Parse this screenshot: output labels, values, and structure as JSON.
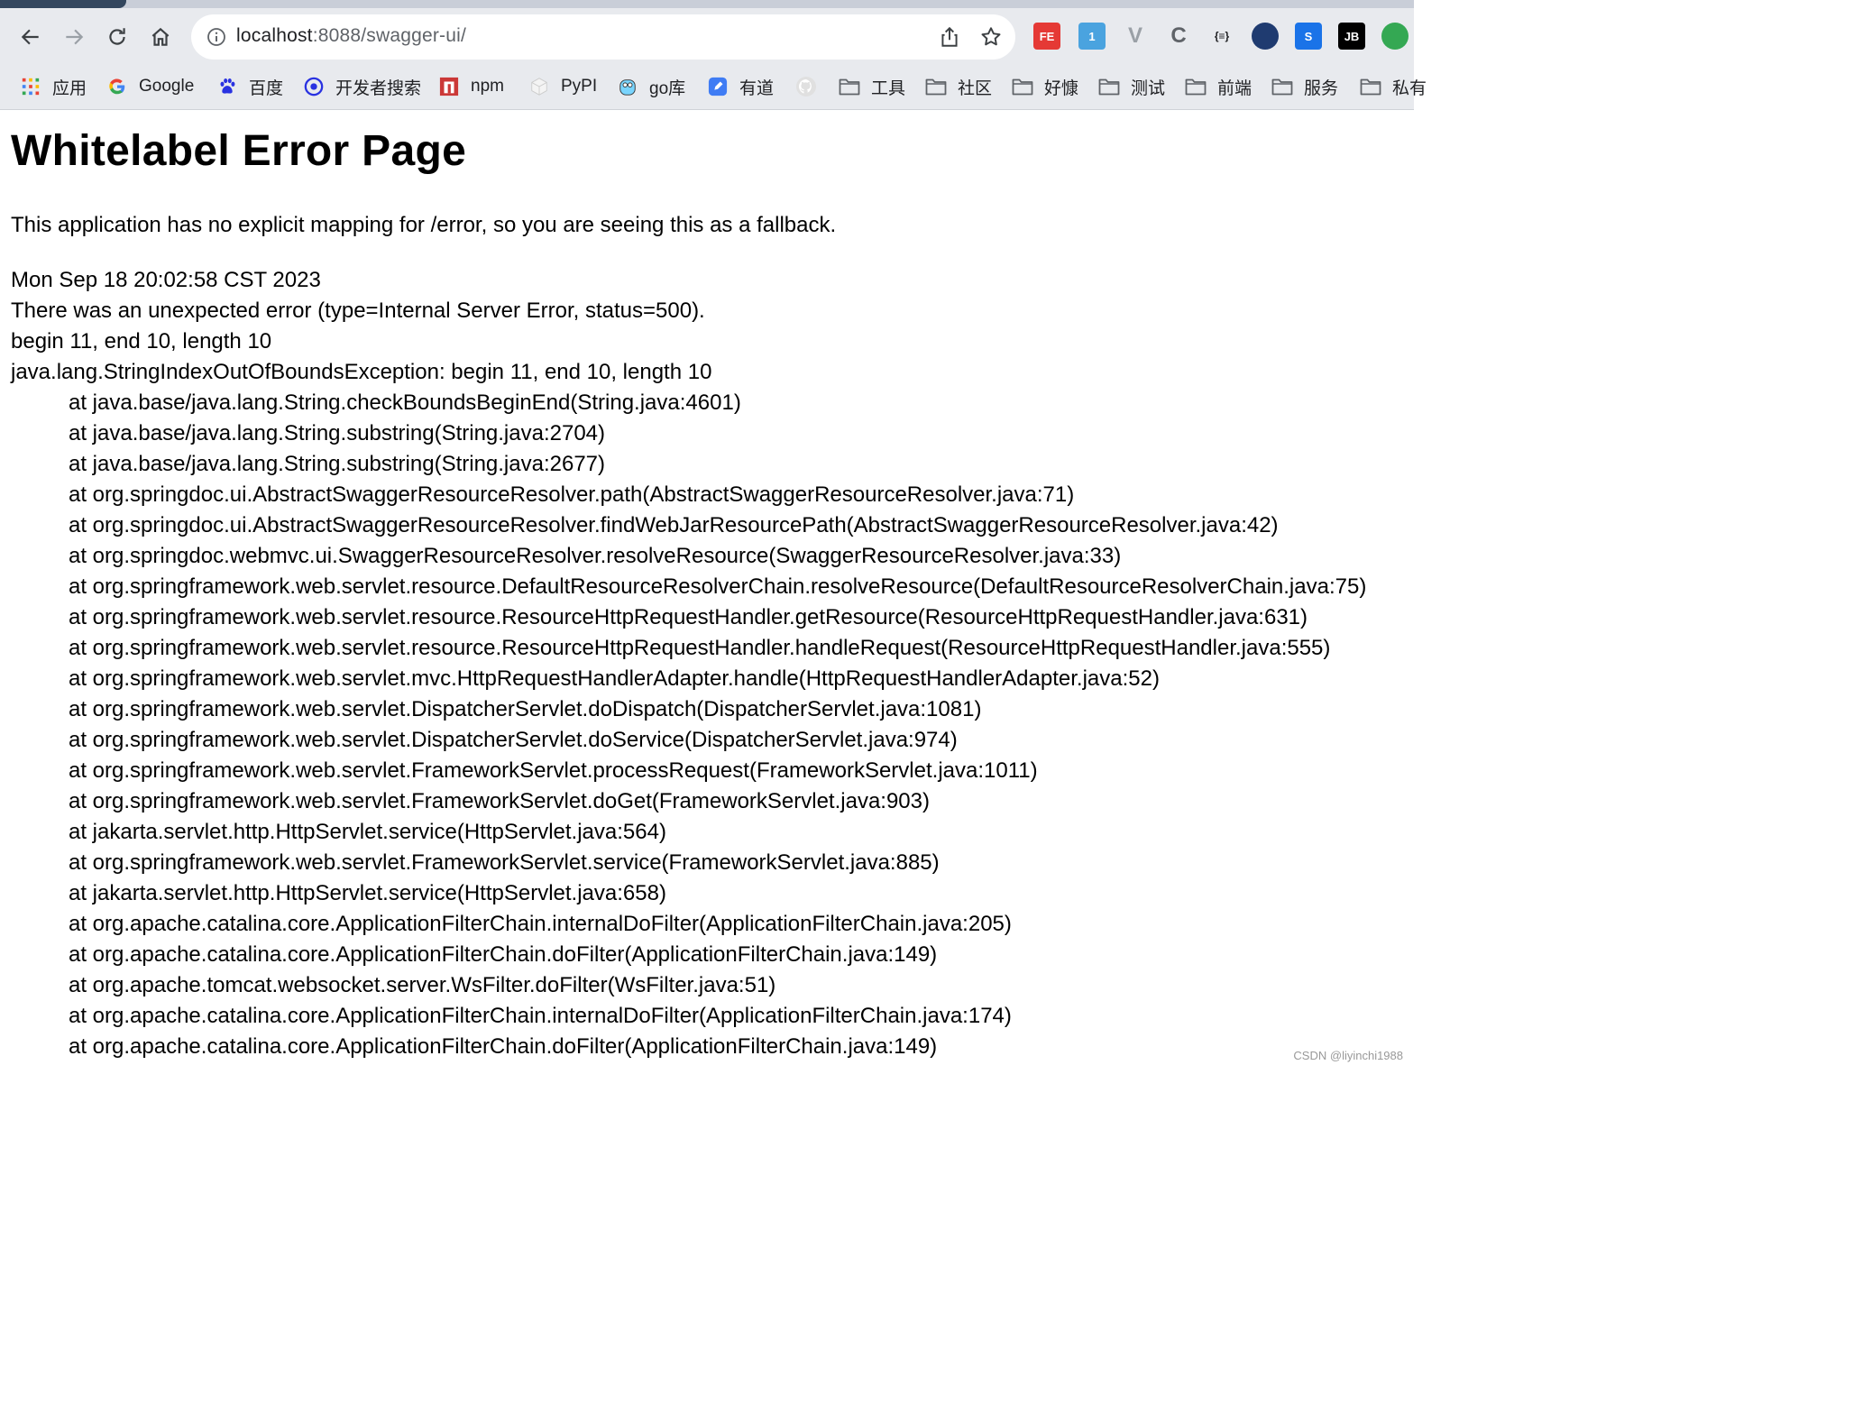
{
  "browser": {
    "address": {
      "host": "localhost",
      "rest": ":8088/swagger-ui/"
    },
    "extensions": [
      {
        "name": "fe-helper-extension",
        "label": "FE",
        "color": "#e53935"
      },
      {
        "name": "screen-capture-extension",
        "label": "1",
        "color": "#4aa3df"
      },
      {
        "name": "vue-devtools-extension",
        "label": "V",
        "color": "#9aa0a6"
      },
      {
        "name": "c-extension",
        "label": "C",
        "color": "#5f6368"
      },
      {
        "name": "json-formatter-extension",
        "label": "{≡}",
        "color": "#202124"
      },
      {
        "name": "compass-extension",
        "label": "",
        "color": "#1f3b70"
      },
      {
        "name": "s-extension",
        "label": "S",
        "color": "#1a73e8"
      },
      {
        "name": "jetbrains-extension",
        "label": "JB",
        "color": "#000000"
      },
      {
        "name": "green-extension",
        "label": "",
        "color": "#34a853"
      }
    ],
    "bookmarks": [
      {
        "label": "应用",
        "icon": "apps-grid-icon"
      },
      {
        "label": "Google",
        "icon": "google-icon"
      },
      {
        "label": "百度",
        "icon": "baidu-paw-icon"
      },
      {
        "label": "开发者搜索",
        "icon": "dev-search-icon"
      },
      {
        "label": "npm",
        "icon": "npm-icon"
      },
      {
        "label": "PyPI",
        "icon": "pypi-icon"
      },
      {
        "label": "go库",
        "icon": "gopher-icon"
      },
      {
        "label": "有道",
        "icon": "youdao-icon"
      },
      {
        "label": "",
        "icon": "github-icon"
      },
      {
        "label": "工具",
        "icon": "folder-icon"
      },
      {
        "label": "社区",
        "icon": "folder-icon"
      },
      {
        "label": "好慷",
        "icon": "folder-icon"
      },
      {
        "label": "测试",
        "icon": "folder-icon"
      },
      {
        "label": "前端",
        "icon": "folder-icon"
      },
      {
        "label": "服务",
        "icon": "folder-icon"
      },
      {
        "label": "私有",
        "icon": "folder-icon"
      }
    ]
  },
  "page": {
    "title": "Whitelabel Error Page",
    "intro": "This application has no explicit mapping for /error, so you are seeing this as a fallback.",
    "timestamp": "Mon Sep 18 20:02:58 CST 2023",
    "error": "There was an unexpected error (type=Internal Server Error, status=500).",
    "message": "begin 11, end 10, length 10",
    "exception": "java.lang.StringIndexOutOfBoundsException: begin 11, end 10, length 10",
    "stack": [
      "at java.base/java.lang.String.checkBoundsBeginEnd(String.java:4601)",
      "at java.base/java.lang.String.substring(String.java:2704)",
      "at java.base/java.lang.String.substring(String.java:2677)",
      "at org.springdoc.ui.AbstractSwaggerResourceResolver.path(AbstractSwaggerResourceResolver.java:71)",
      "at org.springdoc.ui.AbstractSwaggerResourceResolver.findWebJarResourcePath(AbstractSwaggerResourceResolver.java:42)",
      "at org.springdoc.webmvc.ui.SwaggerResourceResolver.resolveResource(SwaggerResourceResolver.java:33)",
      "at org.springframework.web.servlet.resource.DefaultResourceResolverChain.resolveResource(DefaultResourceResolverChain.java:75)",
      "at org.springframework.web.servlet.resource.ResourceHttpRequestHandler.getResource(ResourceHttpRequestHandler.java:631)",
      "at org.springframework.web.servlet.resource.ResourceHttpRequestHandler.handleRequest(ResourceHttpRequestHandler.java:555)",
      "at org.springframework.web.servlet.mvc.HttpRequestHandlerAdapter.handle(HttpRequestHandlerAdapter.java:52)",
      "at org.springframework.web.servlet.DispatcherServlet.doDispatch(DispatcherServlet.java:1081)",
      "at org.springframework.web.servlet.DispatcherServlet.doService(DispatcherServlet.java:974)",
      "at org.springframework.web.servlet.FrameworkServlet.processRequest(FrameworkServlet.java:1011)",
      "at org.springframework.web.servlet.FrameworkServlet.doGet(FrameworkServlet.java:903)",
      "at jakarta.servlet.http.HttpServlet.service(HttpServlet.java:564)",
      "at org.springframework.web.servlet.FrameworkServlet.service(FrameworkServlet.java:885)",
      "at jakarta.servlet.http.HttpServlet.service(HttpServlet.java:658)",
      "at org.apache.catalina.core.ApplicationFilterChain.internalDoFilter(ApplicationFilterChain.java:205)",
      "at org.apache.catalina.core.ApplicationFilterChain.doFilter(ApplicationFilterChain.java:149)",
      "at org.apache.tomcat.websocket.server.WsFilter.doFilter(WsFilter.java:51)",
      "at org.apache.catalina.core.ApplicationFilterChain.internalDoFilter(ApplicationFilterChain.java:174)",
      "at org.apache.catalina.core.ApplicationFilterChain.doFilter(ApplicationFilterChain.java:149)"
    ],
    "watermark": "CSDN @liyinchi1988"
  }
}
